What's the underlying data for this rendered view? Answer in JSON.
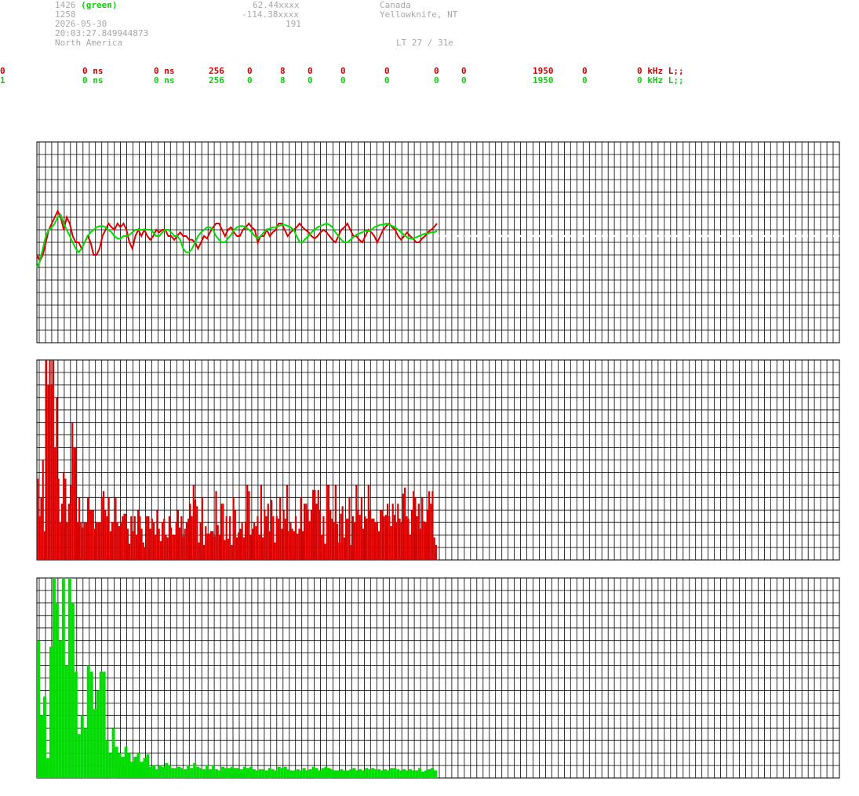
{
  "header": {
    "station_id": "1426",
    "station_color_note": "(green)",
    "station_num": "1258",
    "date": "2026-05-30",
    "time": "20:03:27.849944873",
    "region": "North America",
    "lat": "62.44xxxx",
    "lon": "-114.38xxxx",
    "elev": "191",
    "country": "Canada",
    "city": "Yellowknife, NT",
    "lt": "LT 27 / 31e"
  },
  "channels": [
    {
      "ch": "0",
      "v1": "0 ns",
      "v2": "0 ns",
      "v3": "256",
      "v4": "0",
      "v5": "8",
      "v6": "0",
      "v7": "0",
      "v8": "0",
      "v9": "0",
      "v10": "0",
      "v11": "1950",
      "v12": "0",
      "v13": "0 kHz L;;"
    },
    {
      "ch": "1",
      "v1": "0 ns",
      "v2": "0 ns",
      "v3": "256",
      "v4": "0",
      "v5": "8",
      "v6": "0",
      "v7": "0",
      "v8": "0",
      "v9": "0",
      "v10": "0",
      "v11": "1950",
      "v12": "0",
      "v13": "0 kHz L;;"
    }
  ],
  "colors": {
    "red": "#dd0000",
    "green": "#00dd00",
    "grid": "#000000",
    "label": "#a8a8a8"
  },
  "chart_data": [
    {
      "type": "line",
      "name": "time-series",
      "grid": true,
      "ylim": [
        -8,
        8
      ],
      "xlim": [
        0,
        256
      ],
      "series": [
        {
          "color": "#dd0000",
          "values": [
            -1,
            -1.5,
            -1,
            0,
            1,
            1.5,
            2,
            2.5,
            2,
            1,
            2,
            1.5,
            0.5,
            0,
            0,
            -0.5,
            0,
            0.5,
            0,
            -1,
            -1,
            -0.5,
            0.5,
            1,
            1.5,
            1.2,
            1,
            1.5,
            1.2,
            1.5,
            1,
            0,
            -0.5,
            0.5,
            1,
            0.5,
            1,
            0.5,
            0.2,
            0.5,
            1,
            0.8,
            1,
            1,
            0.5,
            0.5,
            0.2,
            0.5,
            0.8,
            0.5,
            0.5,
            0.2,
            0.2,
            0,
            -0.5,
            0,
            0.5,
            0.3,
            0.8,
            1.2,
            1.5,
            1.5,
            1,
            0.5,
            1,
            1.2,
            0.8,
            0.5,
            0.5,
            1,
            1.2,
            1.5,
            1.2,
            1,
            0,
            0.5,
            0.5,
            1,
            0.5,
            0.8,
            1,
            1.5,
            1.5,
            1,
            0.5,
            0.8,
            1,
            1.2,
            1.5,
            1.2,
            1,
            0.8,
            0.5,
            0.3,
            0.5,
            0.8,
            1,
            0.8,
            0.5,
            0.2,
            0,
            0.5,
            1,
            1.2,
            1.5,
            1,
            0.5,
            0.5,
            0.2,
            0,
            0.5,
            1,
            0.8,
            0.5,
            0,
            0.5,
            1,
            1.3,
            1.5,
            1.2,
            1,
            0.5,
            0.2,
            0.5,
            0.8,
            0.5,
            0.3,
            0,
            0,
            0.3,
            0.5,
            0.8,
            1,
            1.2,
            1.5
          ]
        },
        {
          "color": "#00dd00",
          "values": [
            -2,
            -1.5,
            -0.5,
            0.5,
            1,
            1.2,
            1.5,
            2,
            2.2,
            1.5,
            1,
            0.5,
            0,
            -0.5,
            -0.8,
            -0.5,
            0,
            0.5,
            0.8,
            1,
            1.2,
            1.3,
            1.3,
            1.2,
            1,
            0.8,
            0.5,
            0.3,
            0.3,
            0.5,
            0.5,
            0.6,
            0.8,
            1,
            1,
            1,
            1,
            1,
            1,
            0.8,
            0.5,
            0.5,
            0.8,
            1,
            1,
            0.8,
            0.5,
            0.5,
            0.2,
            -0.5,
            -0.8,
            -0.8,
            -0.5,
            0,
            0.5,
            0.8,
            1,
            1.2,
            1.2,
            1,
            0.5,
            0.2,
            0,
            0,
            0.3,
            0.6,
            1,
            1.2,
            1.3,
            1.3,
            1.2,
            1,
            0.8,
            0.5,
            0.3,
            0.5,
            0.8,
            1,
            1.1,
            1.2,
            1.2,
            1.3,
            1.4,
            1.4,
            1.3,
            1.2,
            1,
            0.5,
            0,
            0,
            0.3,
            0.5,
            0.8,
            1,
            1.2,
            1.3,
            1.4,
            1.5,
            1.4,
            1.2,
            0.8,
            0.5,
            0.2,
            0,
            0,
            0.2,
            0.4,
            0.6,
            0.7,
            0.8,
            0.9,
            0.9,
            1,
            1.2,
            1.3,
            1.4,
            1.4,
            1.5,
            1.4,
            1.3,
            1.2,
            1,
            0.8,
            0.6,
            0.4,
            0.3,
            0.3,
            0.4,
            0.5,
            0.6,
            0.7,
            0.7,
            0.8,
            0.8,
            0.9
          ]
        }
      ]
    },
    {
      "type": "bar",
      "name": "histogram-red",
      "color": "#dd0000",
      "grid": true,
      "ylim": [
        0,
        16
      ],
      "values": [
        6.5,
        3.5,
        5,
        8,
        2.3,
        16,
        14,
        16,
        14,
        16,
        9,
        13,
        6.5,
        3,
        4.5,
        7,
        6.5,
        3,
        4.5,
        6,
        11,
        9,
        9,
        3,
        5,
        3,
        2.6,
        3,
        3,
        5,
        4,
        4,
        4,
        2.5,
        3,
        3,
        3,
        5,
        5.5,
        4,
        3.5,
        5,
        2.3,
        3,
        3,
        5,
        3,
        2.7,
        3,
        3.5,
        3.7,
        3.7,
        2.5,
        1.3,
        3.5,
        2.3,
        3.5,
        2,
        4,
        3.5,
        2.5,
        1.4,
        1,
        3.5,
        3.5,
        2.5,
        3.3,
        3,
        2,
        4,
        2.5,
        1.5,
        3,
        3.3,
        2,
        1.8,
        3.5,
        2.6,
        2,
        2,
        3,
        4,
        2.6,
        3.5,
        1.9,
        2.5,
        3,
        3.3,
        4.5,
        3.5,
        6,
        4.8,
        4.3,
        1.4,
        3,
        5,
        1.2,
        2.7,
        2.1,
        2.1,
        2.3,
        2.3,
        1.9,
        5.5,
        2.8,
        2,
        4.5,
        4.5,
        1.6,
        3.5,
        1.7,
        3.5,
        1.2,
        5,
        4,
        1.8,
        2.2,
        2.5,
        3,
        1.8,
        3,
        6,
        5.5,
        2,
        2.5,
        3,
        2.7,
        3.5,
        2,
        6,
        1.8,
        4,
        3.5,
        4.5,
        2.3,
        4.8,
        3.5,
        1.4,
        3.5,
        3.3,
        5,
        2.5,
        4,
        3.3,
        6,
        2.3,
        3,
        2.5,
        2.3,
        3.5,
        2.1,
        2.5,
        5,
        2.3,
        4.5,
        4.5,
        4,
        3.1,
        4,
        5.6,
        5.6,
        4.5,
        5.6,
        4,
        2,
        3.5,
        1.3,
        6,
        6,
        4,
        3.3,
        3,
        6,
        2.9,
        1.4,
        3.7,
        4.3,
        1.8,
        3.3,
        3.3,
        5,
        1.2,
        3.5,
        3,
        6,
        4,
        3.6,
        5,
        2.5,
        3.5,
        3.3,
        6,
        4,
        3.3,
        3.3,
        3,
        3,
        2.3,
        4,
        4,
        3.5,
        3.6,
        4.5,
        3.5,
        2.7,
        4.5,
        3.6,
        3,
        4.5,
        3.3,
        3,
        5.3,
        5.8,
        3.5,
        3.3,
        2,
        4,
        5.5,
        5,
        3.5,
        4.5,
        2.5,
        5,
        3.1,
        3,
        4,
        5.5,
        4.5,
        5.5,
        1.8,
        1.2
      ]
    },
    {
      "type": "bar",
      "name": "histogram-green",
      "color": "#00dd00",
      "grid": true,
      "ylim": [
        0,
        16
      ],
      "values": [
        11,
        5,
        6.5,
        1.6,
        10.5,
        16,
        14,
        11,
        16,
        9,
        16,
        14,
        8.5,
        3.5,
        5,
        4,
        9,
        8.5,
        5.5,
        7,
        8.5,
        8.5,
        3,
        2,
        4,
        2.5,
        2,
        1.7,
        2.5,
        2,
        1.3,
        1.7,
        2,
        1.3,
        1.6,
        1.9,
        0.9,
        1,
        0.7,
        1,
        0.9,
        1.2,
        1,
        0.8,
        0.8,
        0.9,
        0.8,
        0.7,
        1,
        0.8,
        1.2,
        0.9,
        0.8,
        0.7,
        1,
        0.7,
        1,
        0.7,
        0.6,
        0.9,
        0.8,
        0.8,
        0.9,
        0.8,
        0.8,
        0.7,
        0.9,
        0.8,
        0.9,
        0.7,
        0.6,
        0.7,
        0.7,
        0.6,
        0.8,
        0.7,
        0.6,
        0.9,
        0.8,
        0.9,
        0.7,
        0.6,
        0.6,
        0.7,
        0.6,
        0.8,
        0.6,
        0.7,
        0.9,
        0.8,
        0.6,
        0.8,
        0.9,
        0.8,
        0.7,
        0.6,
        0.6,
        0.7,
        0.6,
        0.6,
        0.7,
        0.8,
        0.6,
        0.7,
        0.6,
        0.8,
        0.7,
        0.8,
        0.7,
        0.7,
        0.6,
        0.7,
        0.6,
        0.8,
        0.8,
        0.7,
        0.6,
        0.7,
        0.6,
        0.7,
        0.6,
        0.6,
        0.8,
        0.5,
        0.6,
        0.7,
        0.8,
        0.6
      ]
    }
  ]
}
